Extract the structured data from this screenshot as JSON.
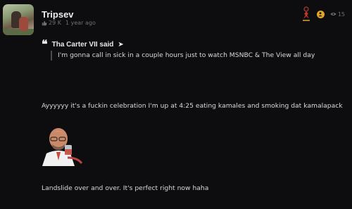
{
  "post": {
    "username": "Tripsev",
    "likes": "29 K",
    "time": "1 year ago",
    "view_count": "15"
  },
  "quote": {
    "author": "Tha Carter VII said",
    "text": "I'm gonna call in sick in a couple hours just to watch MSNBC & The View all day"
  },
  "messages": [
    "Ayyyyyy it's a fuckin celebration I'm up at 4:25 eating kamales and smoking dat kamalapack",
    "Landslide over and over. It's perfect right now haha"
  ],
  "icons": {
    "likes": "thumbs-up-icon",
    "views": "eye-icon",
    "coin": "coin-icon",
    "badge": "user-badge-icon",
    "quote": "quote-mark-icon",
    "arrow": "arrow-right-icon"
  },
  "colors": {
    "background": "#0d0d0f",
    "coin": "#e2a52b",
    "badge": "#c0392b"
  }
}
